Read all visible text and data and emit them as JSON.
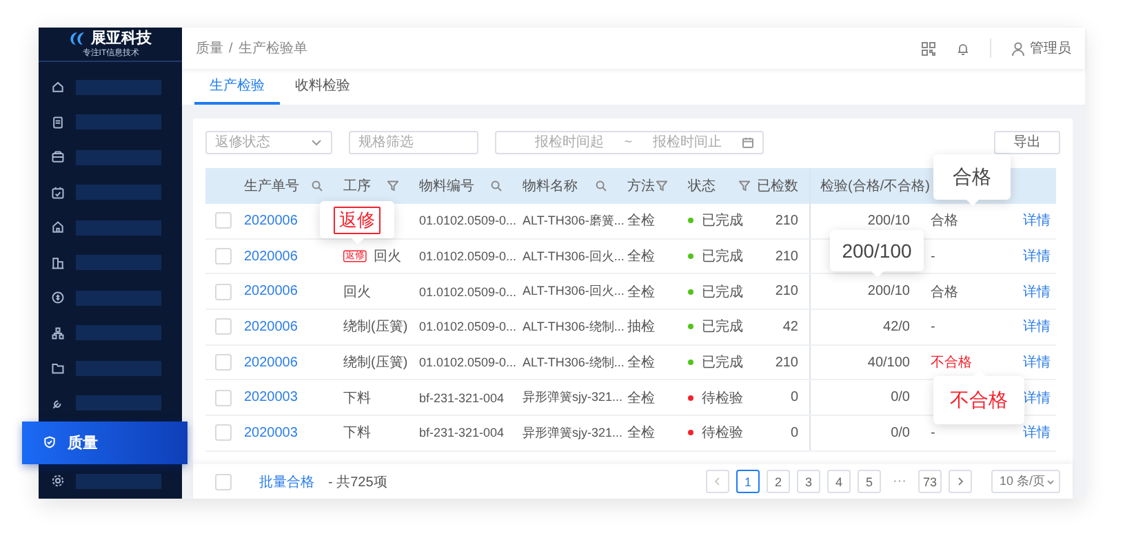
{
  "logo": {
    "title": "展亚科技",
    "subtitle": "专注IT信息技术"
  },
  "sidebar": {
    "items": [
      {
        "selected": false
      },
      {
        "selected": false
      },
      {
        "selected": false
      },
      {
        "selected": false
      },
      {
        "selected": false
      },
      {
        "selected": false
      },
      {
        "selected": false
      },
      {
        "selected": false
      },
      {
        "selected": false
      },
      {
        "selected": false
      },
      {
        "label": "质量",
        "selected": true
      },
      {
        "selected": false
      }
    ]
  },
  "breadcrumb": {
    "items": [
      "质量",
      "生产检验单"
    ],
    "separator": "/"
  },
  "user": {
    "name": "管理员"
  },
  "tabs": [
    {
      "label": "生产检验",
      "selected": true
    },
    {
      "label": "收料检验",
      "selected": false
    }
  ],
  "filters": {
    "status_select": {
      "placeholder": "返修状态"
    },
    "spec_field": {
      "placeholder": "规格筛选"
    },
    "date_range": {
      "start_placeholder": "报检时间起",
      "separator": "~",
      "end_placeholder": "报检时间止"
    },
    "export_button": "导出"
  },
  "table": {
    "columns": [
      {
        "label": "生产单号",
        "kind": "search"
      },
      {
        "label": "工序",
        "kind": "filter"
      },
      {
        "label": "物料编号",
        "kind": "search"
      },
      {
        "label": "物料名称",
        "kind": "search"
      },
      {
        "label": "方法",
        "kind": "filter"
      },
      {
        "label": "状态",
        "kind": "filter"
      },
      {
        "label": "已检数",
        "kind": "plain"
      },
      {
        "label": "检验(合格/不合格)",
        "kind": "plain"
      }
    ],
    "rows": [
      {
        "checked": false,
        "order": "2020006",
        "code": "01.0102.0509-0...",
        "name": "ALT-TH306-磨簧...",
        "method": "全检",
        "status": "已完成",
        "color": "#52c41a",
        "checked_count": "210",
        "inspection": "200/10",
        "result": "合格",
        "result_failed": false,
        "action": "详情"
      },
      {
        "checked": false,
        "order": "2020006",
        "tag": "返修",
        "step": "回火",
        "code": "01.0102.0509-0...",
        "name": "ALT-TH306-回火...",
        "method": "全检",
        "status": "已完成",
        "color": "#52c41a",
        "checked_count": "210",
        "result": "-",
        "result_failed": false,
        "action": "详情"
      },
      {
        "checked": false,
        "order": "2020006",
        "step": "回火",
        "code": "01.0102.0509-0...",
        "name": "ALT-TH306-回火...",
        "method": "全检",
        "status": "已完成",
        "color": "#52c41a",
        "checked_count": "210",
        "inspection": "200/10",
        "result": "合格",
        "result_failed": false,
        "action": "详情"
      },
      {
        "checked": false,
        "order": "2020006",
        "step": "绕制(压簧)",
        "code": "01.0102.0509-0...",
        "name": "ALT-TH306-绕制...",
        "method": "抽检",
        "status": "已完成",
        "color": "#52c41a",
        "checked_count": "42",
        "inspection": "42/0",
        "result": "-",
        "result_failed": false,
        "action": "详情"
      },
      {
        "checked": false,
        "order": "2020006",
        "step": "绕制(压簧)",
        "code": "01.0102.0509-0...",
        "name": "ALT-TH306-绕制...",
        "method": "全检",
        "status": "已完成",
        "color": "#52c41a",
        "checked_count": "210",
        "inspection": "40/100",
        "result": "不合格",
        "result_failed": true,
        "action": "详情"
      },
      {
        "checked": false,
        "order": "2020003",
        "step": "下料",
        "code": "bf-231-321-004",
        "name": "异形弹簧sjy-321...",
        "method": "全检",
        "status": "待检验",
        "color": "#f5222d",
        "checked_count": "0",
        "inspection": "0/0",
        "action": "详情"
      },
      {
        "checked": false,
        "order": "2020003",
        "step": "下料",
        "code": "bf-231-321-004",
        "name": "异形弹簧sjy-321...",
        "method": "全检",
        "status": "待检验",
        "color": "#f5222d",
        "checked_count": "0",
        "inspection": "0/0",
        "result": "-",
        "result_failed": false,
        "action": "详情"
      }
    ]
  },
  "footer": {
    "select_all_checked": false,
    "batch_link": "批量合格",
    "total": "- 共725项"
  },
  "pagination": {
    "pages": [
      {
        "label": "1",
        "selected": true
      },
      {
        "label": "2",
        "selected": false
      },
      {
        "label": "3",
        "selected": false
      },
      {
        "label": "4",
        "selected": false
      },
      {
        "label": "5",
        "selected": false
      },
      {
        "label": "···",
        "kind": "ellipsis"
      },
      {
        "label": "73",
        "selected": false
      }
    ],
    "page_size": "10 条/页"
  },
  "callouts": [
    {
      "text": "返修",
      "kind": "tag"
    },
    {
      "text": "合格",
      "kind": "text"
    },
    {
      "text": "200/100",
      "kind": "text"
    },
    {
      "text": "不合格",
      "kind": "error"
    }
  ]
}
